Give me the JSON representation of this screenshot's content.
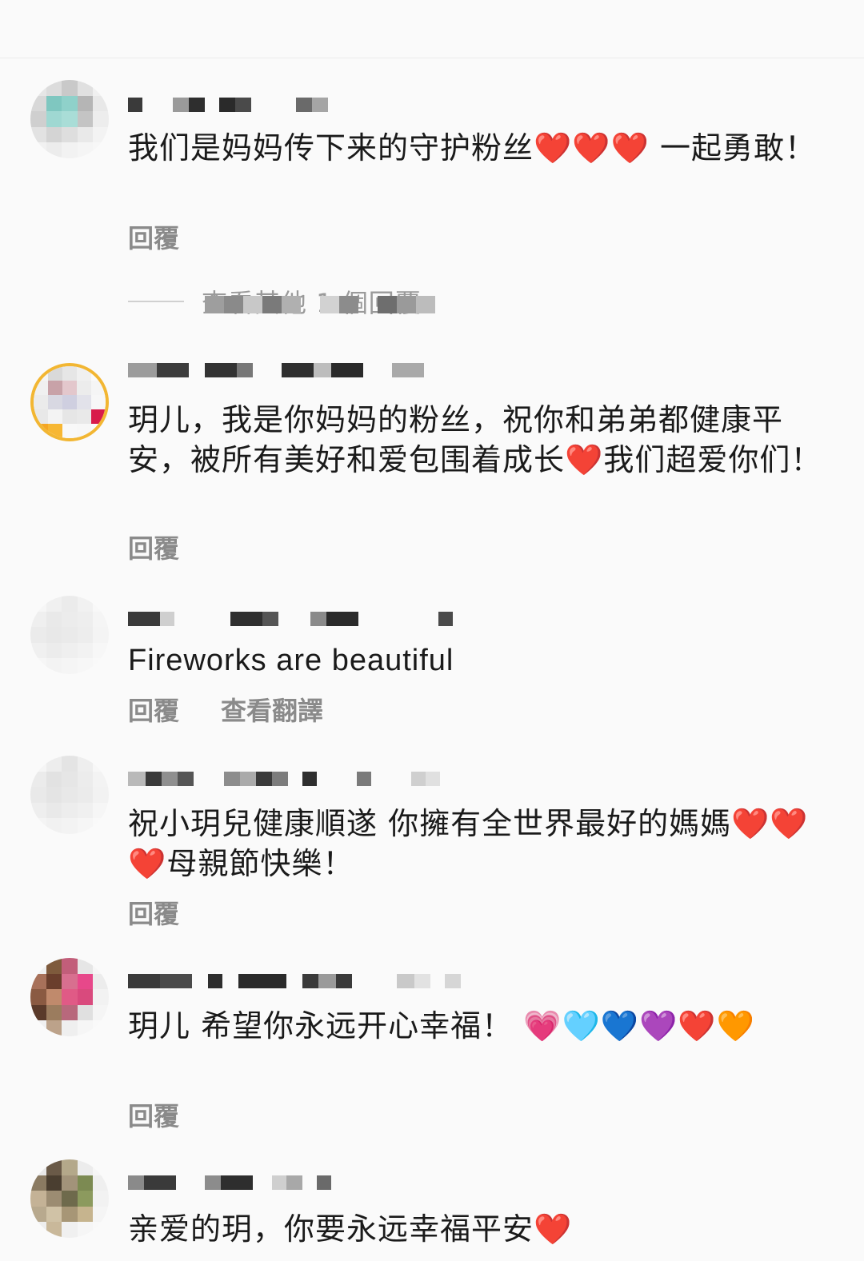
{
  "comments": [
    {
      "text": "我们是妈妈传下来的守护粉丝❤️❤️❤️ 一起勇敢！",
      "reply_label": "回覆"
    },
    {
      "text": "玥儿，我是你妈妈的粉丝，祝你和弟弟都健康平安，被所有美好和爱包围着成长❤️我们超爱你们！",
      "reply_label": "回覆"
    },
    {
      "text": "Fireworks are beautiful",
      "reply_label": "回覆",
      "translate_label": "查看翻譯"
    },
    {
      "text": "祝小玥兒健康順遂 你擁有全世界最好的媽媽❤️❤️❤️母親節快樂！",
      "reply_label": "回覆"
    },
    {
      "text": "玥儿 希望你永远开心幸福！ 💗🩵💙💜❤️🧡",
      "reply_label": "回覆"
    },
    {
      "text": "亲爱的玥，你要永远幸福平安❤️"
    }
  ],
  "view_replies": {
    "label": "查看其他 1 個回覆"
  }
}
